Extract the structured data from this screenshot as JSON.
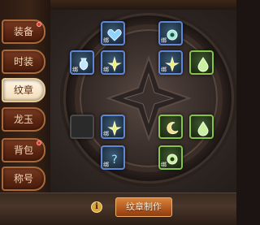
{
  "sidebar": {
    "tabs": [
      {
        "label": "装备",
        "badge": true
      },
      {
        "label": "时装",
        "badge": false
      },
      {
        "label": "纹章",
        "badge": false
      },
      {
        "label": "龙玉",
        "badge": false
      },
      {
        "label": "背包",
        "badge": true
      },
      {
        "label": "称号",
        "badge": false
      }
    ],
    "active_tab": "纹章"
  },
  "emblem_slots": [
    {
      "icon": "heart-emblem-icon",
      "tier": "blue",
      "marker": "绑"
    },
    {
      "icon": "gear-emblem-icon",
      "tier": "blue",
      "marker": "绑"
    },
    {
      "icon": "vase-emblem-icon",
      "tier": "blue",
      "marker": "绑"
    },
    {
      "icon": "dagger-emblem-icon",
      "tier": "blue",
      "marker": "绑"
    },
    {
      "icon": "dagger-emblem-icon",
      "tier": "blue",
      "marker": "绑"
    },
    {
      "icon": "drop-emblem-icon",
      "tier": "green",
      "marker": ""
    },
    {
      "icon": "empty-slot-icon",
      "tier": "empty",
      "marker": ""
    },
    {
      "icon": "dagger-emblem-icon",
      "tier": "blue",
      "marker": "绑"
    },
    {
      "icon": "moon-emblem-icon",
      "tier": "green",
      "marker": ""
    },
    {
      "icon": "drop-emblem-icon",
      "tier": "green",
      "marker": ""
    },
    {
      "icon": "question-emblem-icon",
      "tier": "blue",
      "marker": "绑"
    },
    {
      "icon": "gear-emblem-icon",
      "tier": "green",
      "marker": "绑"
    }
  ],
  "footer": {
    "info_label": "i",
    "make_button_label": "纹章制作"
  },
  "colors": {
    "blue_tier": "#5f87d6",
    "green_tier": "#86c348",
    "badge_red": "#e8332b",
    "button_orange": "#b1561d"
  }
}
